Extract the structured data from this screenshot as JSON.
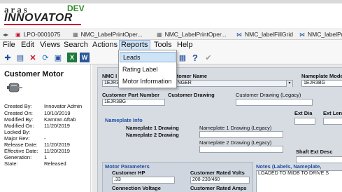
{
  "app": {
    "logo_top": "aras",
    "logo_main": "INNOVATOR",
    "logo_tag": "DEV"
  },
  "colors": {
    "accent": "#c8102e",
    "dev": "#2e8b2e",
    "menu_highlight": "#cfe3f6",
    "form_bg": "#d7dce3",
    "label_blue": "#1f4ea0"
  },
  "tabs": [
    {
      "label": "LPO-0001075",
      "icon": "part-icon"
    },
    {
      "label": "NMC_LabelPrintOper...",
      "icon": "grid-icon"
    },
    {
      "label": "NMC_LabelPrintOper...",
      "icon": "grid-icon"
    },
    {
      "label": "NMC_labelFillGrid",
      "icon": "method-icon"
    },
    {
      "label": "NMC_labelPrint",
      "icon": "method-icon"
    }
  ],
  "menu": {
    "file": "File",
    "edit": "Edit",
    "views": "Views",
    "search": "Search",
    "actions": "Actions",
    "reports": "Reports",
    "tools": "Tools",
    "help": "Help"
  },
  "reports_menu": {
    "items": [
      "Leads",
      "Rating Label",
      "Motor Information"
    ]
  },
  "item": {
    "title": "Customer Motor",
    "properties": [
      {
        "label": "Created By:",
        "value": "Innovator Admin"
      },
      {
        "label": "Created On:",
        "value": "10/10/2019"
      },
      {
        "label": "Modified By:",
        "value": "Kamran Aftab"
      },
      {
        "label": "Modified On:",
        "value": "11/20/2019"
      },
      {
        "label": "Locked By:",
        "value": ""
      },
      {
        "label": "Major Rev:",
        "value": "-"
      },
      {
        "label": "Release Date:",
        "value": "11/20/2019"
      },
      {
        "label": "Effective Date:",
        "value": "11/20/2019"
      },
      {
        "label": "Generation:",
        "value": "1"
      },
      {
        "label": "State:",
        "value": "Released"
      }
    ]
  },
  "form": {
    "nmc_id_label": "NMC I",
    "nmc_id_value": "1EJR3BG",
    "customer_name_label": "ustomer Name",
    "customer_name_value": "AINGER",
    "nameplate_model_label": "Nameplate Mode",
    "nameplate_model_value": "1EJR3BG",
    "customer_part_number_label": "Customer Part Number",
    "customer_part_number_value": "1EJR3BG",
    "customer_drawing_label": "Customer Drawing",
    "customer_drawing_legacy_label": "Customer Drawing (Legacy)",
    "nameplate_info_label": "Nameplate Info",
    "nameplate_drawing1_label": "Nameplate 1 Drawing",
    "nameplate_drawing2_label": "Nameplate 2 Drawing",
    "nameplate_drawing1_legacy_label": "Nameplate 1 Drawing (Legacy)",
    "nameplate_drawing2_legacy_label": "Nameplate 2 Drawing (Legacy)",
    "ext_dia_label": "Ext Dia",
    "ext_len_label": "Ext Len",
    "shaft_ext_desc_label": "Shaft Ext Desc",
    "motor_parameters_label": "Motor Parameters",
    "customer_hp_label": "Customer HP",
    "customer_hp_value": ".33",
    "customer_rated_volts_label": "Customer Rated Volts",
    "customer_rated_volts_value": "208-230/460",
    "connection_voltage_label": "Connection Voltage",
    "customer_rated_amps_label": "Customer Rated Amps",
    "notes_label": "Notes (Labels, Nameplate,",
    "notes_value": "LOADED TO MIDB TO DRIVE S"
  }
}
